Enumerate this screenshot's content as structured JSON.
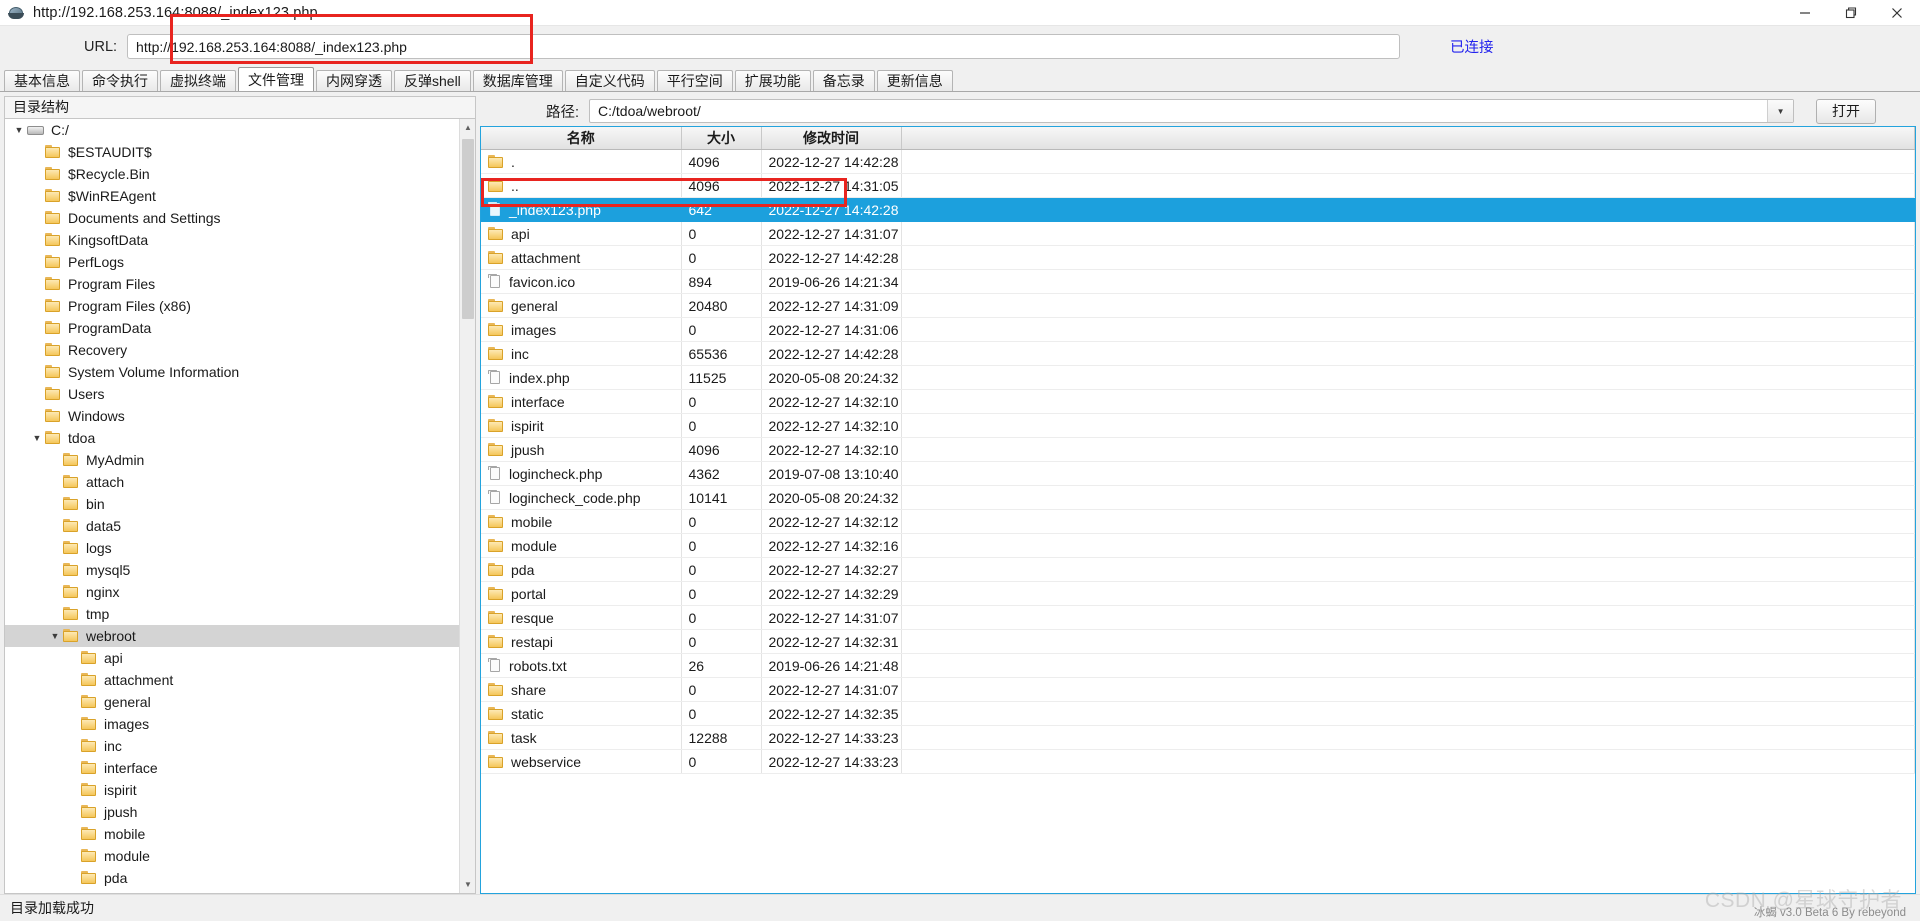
{
  "window": {
    "title": "http://192.168.253.164:8088/_index123.php",
    "icon": "globe-icon",
    "minimize_label": "–",
    "maximize_label": "❐",
    "close_label": "✕"
  },
  "url_bar": {
    "label": "URL:",
    "value": "http://192.168.253.164:8088/_index123.php",
    "placeholder": "http://",
    "connection_status": "已连接",
    "connection_color": "#2222ee",
    "highlight_color": "#e8241f"
  },
  "tabs": [
    {
      "label": "基本信息",
      "active": false
    },
    {
      "label": "命令执行",
      "active": false
    },
    {
      "label": "虚拟终端",
      "active": false
    },
    {
      "label": "文件管理",
      "active": true
    },
    {
      "label": "内网穿透",
      "active": false
    },
    {
      "label": "反弹shell",
      "active": false
    },
    {
      "label": "数据库管理",
      "active": false
    },
    {
      "label": "自定义代码",
      "active": false
    },
    {
      "label": "平行空间",
      "active": false
    },
    {
      "label": "扩展功能",
      "active": false
    },
    {
      "label": "备忘录",
      "active": false
    },
    {
      "label": "更新信息",
      "active": false
    }
  ],
  "tree": {
    "header": "目录结构",
    "nodes": [
      {
        "label": "C:/",
        "depth": 0,
        "icon": "drive-icon",
        "expanded": true,
        "selected": false
      },
      {
        "label": "$ESTAUDIT$",
        "depth": 1,
        "icon": "folder-icon",
        "expanded": null,
        "selected": false
      },
      {
        "label": "$Recycle.Bin",
        "depth": 1,
        "icon": "folder-icon",
        "expanded": null,
        "selected": false
      },
      {
        "label": "$WinREAgent",
        "depth": 1,
        "icon": "folder-icon",
        "expanded": null,
        "selected": false
      },
      {
        "label": "Documents and Settings",
        "depth": 1,
        "icon": "folder-icon",
        "expanded": null,
        "selected": false
      },
      {
        "label": "KingsoftData",
        "depth": 1,
        "icon": "folder-icon",
        "expanded": null,
        "selected": false
      },
      {
        "label": "PerfLogs",
        "depth": 1,
        "icon": "folder-icon",
        "expanded": null,
        "selected": false
      },
      {
        "label": "Program Files",
        "depth": 1,
        "icon": "folder-icon",
        "expanded": null,
        "selected": false
      },
      {
        "label": "Program Files (x86)",
        "depth": 1,
        "icon": "folder-icon",
        "expanded": null,
        "selected": false
      },
      {
        "label": "ProgramData",
        "depth": 1,
        "icon": "folder-icon",
        "expanded": null,
        "selected": false
      },
      {
        "label": "Recovery",
        "depth": 1,
        "icon": "folder-icon",
        "expanded": null,
        "selected": false
      },
      {
        "label": "System Volume Information",
        "depth": 1,
        "icon": "folder-icon",
        "expanded": null,
        "selected": false
      },
      {
        "label": "Users",
        "depth": 1,
        "icon": "folder-icon",
        "expanded": null,
        "selected": false
      },
      {
        "label": "Windows",
        "depth": 1,
        "icon": "folder-icon",
        "expanded": null,
        "selected": false
      },
      {
        "label": "tdoa",
        "depth": 1,
        "icon": "folder-icon",
        "expanded": true,
        "selected": false
      },
      {
        "label": "MyAdmin",
        "depth": 2,
        "icon": "folder-icon",
        "expanded": null,
        "selected": false
      },
      {
        "label": "attach",
        "depth": 2,
        "icon": "folder-icon",
        "expanded": null,
        "selected": false
      },
      {
        "label": "bin",
        "depth": 2,
        "icon": "folder-icon",
        "expanded": null,
        "selected": false
      },
      {
        "label": "data5",
        "depth": 2,
        "icon": "folder-icon",
        "expanded": null,
        "selected": false
      },
      {
        "label": "logs",
        "depth": 2,
        "icon": "folder-icon",
        "expanded": null,
        "selected": false
      },
      {
        "label": "mysql5",
        "depth": 2,
        "icon": "folder-icon",
        "expanded": null,
        "selected": false
      },
      {
        "label": "nginx",
        "depth": 2,
        "icon": "folder-icon",
        "expanded": null,
        "selected": false
      },
      {
        "label": "tmp",
        "depth": 2,
        "icon": "folder-icon",
        "expanded": null,
        "selected": false
      },
      {
        "label": "webroot",
        "depth": 2,
        "icon": "folder-icon",
        "expanded": true,
        "selected": true
      },
      {
        "label": "api",
        "depth": 3,
        "icon": "folder-icon",
        "expanded": null,
        "selected": false
      },
      {
        "label": "attachment",
        "depth": 3,
        "icon": "folder-icon",
        "expanded": null,
        "selected": false
      },
      {
        "label": "general",
        "depth": 3,
        "icon": "folder-icon",
        "expanded": null,
        "selected": false
      },
      {
        "label": "images",
        "depth": 3,
        "icon": "folder-icon",
        "expanded": null,
        "selected": false
      },
      {
        "label": "inc",
        "depth": 3,
        "icon": "folder-icon",
        "expanded": null,
        "selected": false
      },
      {
        "label": "interface",
        "depth": 3,
        "icon": "folder-icon",
        "expanded": null,
        "selected": false
      },
      {
        "label": "ispirit",
        "depth": 3,
        "icon": "folder-icon",
        "expanded": null,
        "selected": false
      },
      {
        "label": "jpush",
        "depth": 3,
        "icon": "folder-icon",
        "expanded": null,
        "selected": false
      },
      {
        "label": "mobile",
        "depth": 3,
        "icon": "folder-icon",
        "expanded": null,
        "selected": false
      },
      {
        "label": "module",
        "depth": 3,
        "icon": "folder-icon",
        "expanded": null,
        "selected": false
      },
      {
        "label": "pda",
        "depth": 3,
        "icon": "folder-icon",
        "expanded": null,
        "selected": false
      }
    ]
  },
  "path_bar": {
    "label": "路径:",
    "value": "C:/tdoa/webroot/",
    "placeholder": "",
    "dropdown_icon": "chevron-down-icon",
    "open_button": "打开"
  },
  "file_table": {
    "columns": [
      "名称",
      "大小",
      "修改时间",
      ""
    ],
    "rows": [
      {
        "name": ".",
        "size": "4096",
        "mtime": "2022-12-27 14:42:28",
        "icon": "folder-icon",
        "selected": false
      },
      {
        "name": "..",
        "size": "4096",
        "mtime": "2022-12-27 14:31:05",
        "icon": "folder-icon",
        "selected": false
      },
      {
        "name": "_index123.php",
        "size": "642",
        "mtime": "2022-12-27 14:42:28",
        "icon": "document-icon",
        "selected": true
      },
      {
        "name": "api",
        "size": "0",
        "mtime": "2022-12-27 14:31:07",
        "icon": "folder-icon",
        "selected": false
      },
      {
        "name": "attachment",
        "size": "0",
        "mtime": "2022-12-27 14:42:28",
        "icon": "folder-icon",
        "selected": false
      },
      {
        "name": "favicon.ico",
        "size": "894",
        "mtime": "2019-06-26 14:21:34",
        "icon": "document-icon",
        "selected": false
      },
      {
        "name": "general",
        "size": "20480",
        "mtime": "2022-12-27 14:31:09",
        "icon": "folder-icon",
        "selected": false
      },
      {
        "name": "images",
        "size": "0",
        "mtime": "2022-12-27 14:31:06",
        "icon": "folder-icon",
        "selected": false
      },
      {
        "name": "inc",
        "size": "65536",
        "mtime": "2022-12-27 14:42:28",
        "icon": "folder-icon",
        "selected": false
      },
      {
        "name": "index.php",
        "size": "11525",
        "mtime": "2020-05-08 20:24:32",
        "icon": "document-icon",
        "selected": false
      },
      {
        "name": "interface",
        "size": "0",
        "mtime": "2022-12-27 14:32:10",
        "icon": "folder-icon",
        "selected": false
      },
      {
        "name": "ispirit",
        "size": "0",
        "mtime": "2022-12-27 14:32:10",
        "icon": "folder-icon",
        "selected": false
      },
      {
        "name": "jpush",
        "size": "4096",
        "mtime": "2022-12-27 14:32:10",
        "icon": "folder-icon",
        "selected": false
      },
      {
        "name": "logincheck.php",
        "size": "4362",
        "mtime": "2019-07-08 13:10:40",
        "icon": "document-icon",
        "selected": false
      },
      {
        "name": "logincheck_code.php",
        "size": "10141",
        "mtime": "2020-05-08 20:24:32",
        "icon": "document-icon",
        "selected": false
      },
      {
        "name": "mobile",
        "size": "0",
        "mtime": "2022-12-27 14:32:12",
        "icon": "folder-icon",
        "selected": false
      },
      {
        "name": "module",
        "size": "0",
        "mtime": "2022-12-27 14:32:16",
        "icon": "folder-icon",
        "selected": false
      },
      {
        "name": "pda",
        "size": "0",
        "mtime": "2022-12-27 14:32:27",
        "icon": "folder-icon",
        "selected": false
      },
      {
        "name": "portal",
        "size": "0",
        "mtime": "2022-12-27 14:32:29",
        "icon": "folder-icon",
        "selected": false
      },
      {
        "name": "resque",
        "size": "0",
        "mtime": "2022-12-27 14:31:07",
        "icon": "folder-icon",
        "selected": false
      },
      {
        "name": "restapi",
        "size": "0",
        "mtime": "2022-12-27 14:32:31",
        "icon": "folder-icon",
        "selected": false
      },
      {
        "name": "robots.txt",
        "size": "26",
        "mtime": "2019-06-26 14:21:48",
        "icon": "document-icon",
        "selected": false
      },
      {
        "name": "share",
        "size": "0",
        "mtime": "2022-12-27 14:31:07",
        "icon": "folder-icon",
        "selected": false
      },
      {
        "name": "static",
        "size": "0",
        "mtime": "2022-12-27 14:32:35",
        "icon": "folder-icon",
        "selected": false
      },
      {
        "name": "task",
        "size": "12288",
        "mtime": "2022-12-27 14:33:23",
        "icon": "folder-icon",
        "selected": false
      },
      {
        "name": "webservice",
        "size": "0",
        "mtime": "2022-12-27 14:33:23",
        "icon": "folder-icon",
        "selected": false
      }
    ],
    "selection_color": "#1ca0dd",
    "highlight_color": "#e8241f"
  },
  "status_bar": {
    "message": "目录加载成功",
    "version": "冰蝎 v3.0 Beta 6    By rebeyond",
    "watermark": "CSDN @星球守护者"
  }
}
